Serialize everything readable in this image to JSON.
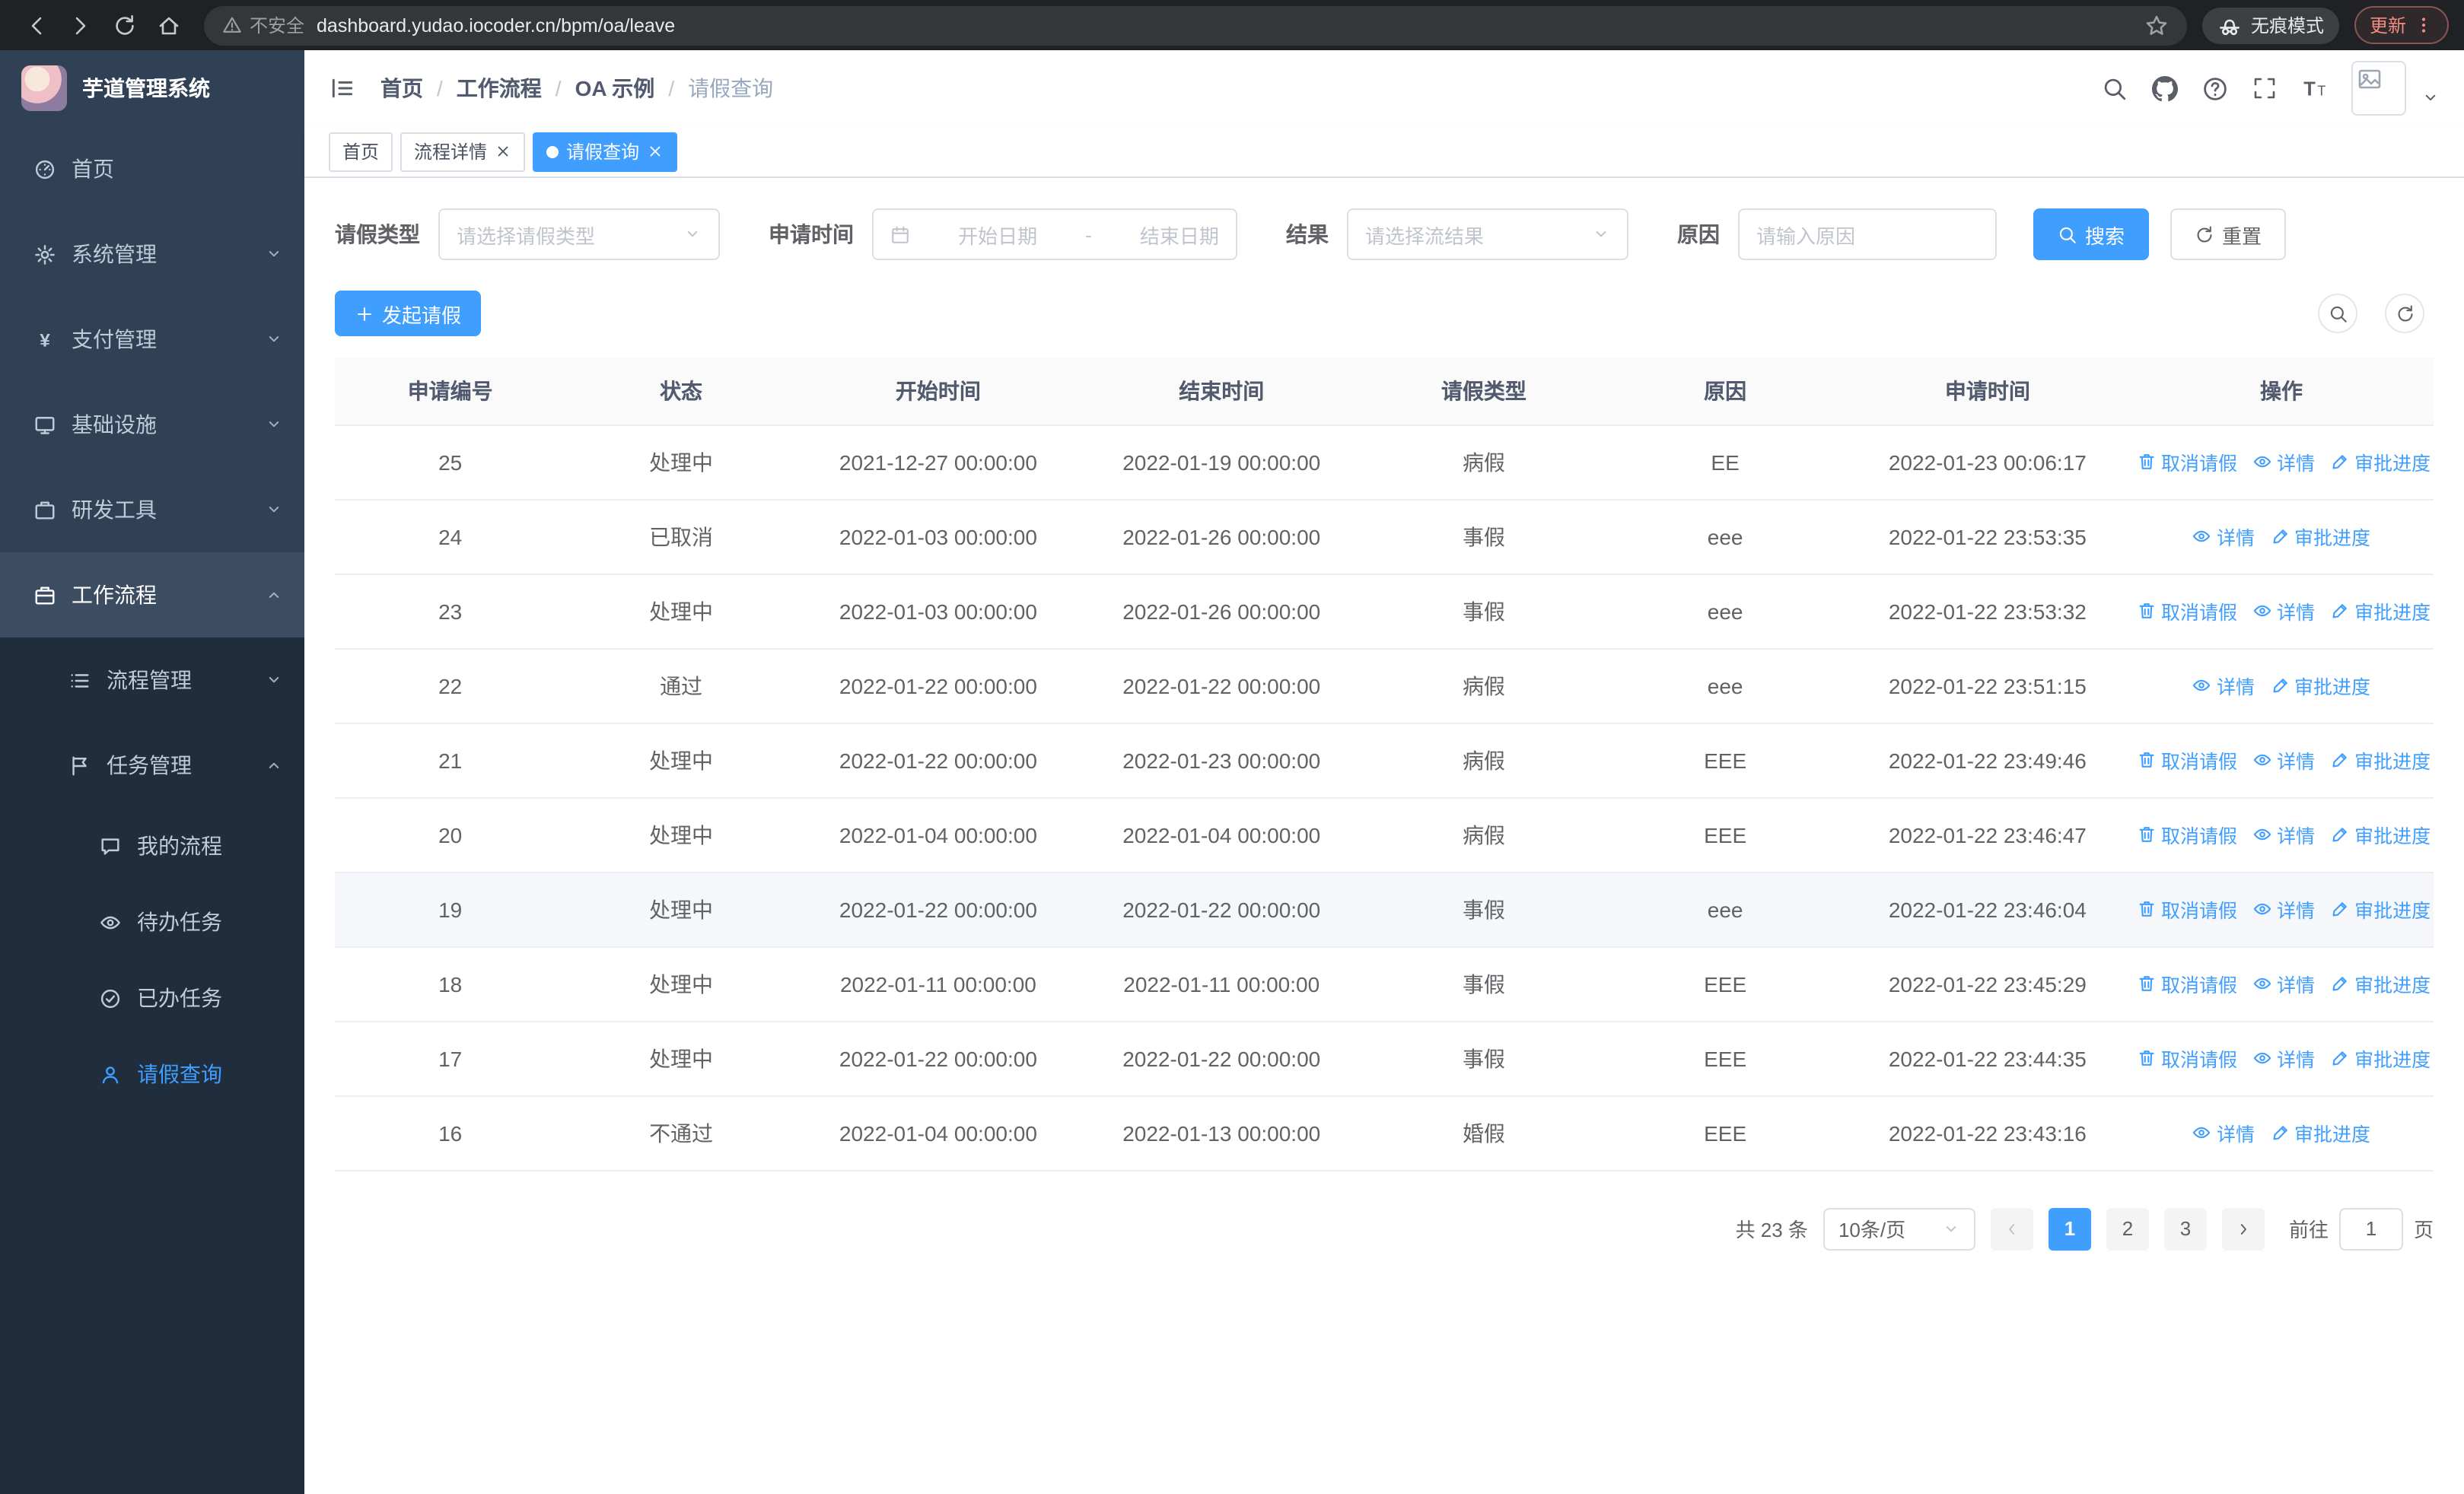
{
  "browser": {
    "security_warning": "不安全",
    "url": "dashboard.yudao.iocoder.cn/bpm/oa/leave",
    "incognito_label": "无痕模式",
    "update_label": "更新"
  },
  "sidebar": {
    "logo_title": "芋道管理系统",
    "top_items": [
      {
        "key": "home",
        "label": "首页",
        "icon": "home-icon"
      },
      {
        "key": "system",
        "label": "系统管理",
        "icon": "gear-icon",
        "chevron": "down"
      },
      {
        "key": "payment",
        "label": "支付管理",
        "icon": "yen-icon",
        "chevron": "down"
      },
      {
        "key": "infrastructure",
        "label": "基础设施",
        "icon": "monitor-icon",
        "chevron": "down"
      },
      {
        "key": "devtools",
        "label": "研发工具",
        "icon": "briefcase-icon",
        "chevron": "down"
      },
      {
        "key": "workflow",
        "label": "工作流程",
        "icon": "suitcase-icon",
        "chevron": "up",
        "open": true
      }
    ],
    "sub_items": [
      {
        "key": "process-mgmt",
        "label": "流程管理",
        "icon": "list-icon",
        "level": 2,
        "chevron": "down"
      },
      {
        "key": "task-mgmt",
        "label": "任务管理",
        "icon": "flag-icon",
        "level": 2,
        "chevron": "up"
      },
      {
        "key": "my-process",
        "label": "我的流程",
        "icon": "chat-icon",
        "level": 3
      },
      {
        "key": "todo-tasks",
        "label": "待办任务",
        "icon": "eye-icon",
        "level": 3
      },
      {
        "key": "done-tasks",
        "label": "已办任务",
        "icon": "check-circle-icon",
        "level": 3
      },
      {
        "key": "leave-query",
        "label": "请假查询",
        "icon": "user-icon",
        "level": 3,
        "active": true
      }
    ]
  },
  "header": {
    "breadcrumb_separator": "/",
    "breadcrumbs": [
      "首页",
      "工作流程",
      "OA 示例",
      "请假查询"
    ],
    "icons": [
      "search-icon",
      "github-icon",
      "help-icon",
      "fullscreen-icon",
      "font-size-icon",
      "user-avatar"
    ]
  },
  "tabs": [
    {
      "key": "home",
      "label": "首页",
      "closable": false,
      "active": false
    },
    {
      "key": "process-detail",
      "label": "流程详情",
      "closable": true,
      "active": false
    },
    {
      "key": "leave-query",
      "label": "请假查询",
      "closable": true,
      "active": true
    }
  ],
  "filters": {
    "leave_type_label": "请假类型",
    "leave_type_placeholder": "请选择请假类型",
    "apply_time_label": "申请时间",
    "start_date_placeholder": "开始日期",
    "range_separator": "-",
    "end_date_placeholder": "结束日期",
    "result_label": "结果",
    "result_placeholder": "请选择流结果",
    "reason_label": "原因",
    "reason_placeholder": "请输入原因",
    "search_button": "搜索",
    "reset_button": "重置"
  },
  "toolbar": {
    "create_button": "发起请假"
  },
  "table": {
    "columns": [
      "申请编号",
      "状态",
      "开始时间",
      "结束时间",
      "请假类型",
      "原因",
      "申请时间",
      "操作"
    ],
    "action_labels": {
      "cancel": "取消请假",
      "detail": "详情",
      "progress": "审批进度"
    },
    "action_icons": {
      "cancel": "trash-icon",
      "detail": "eye-icon",
      "progress": "edit-icon"
    },
    "rows": [
      {
        "id": "25",
        "status": "处理中",
        "start": "2021-12-27 00:00:00",
        "end": "2022-01-19 00:00:00",
        "type": "病假",
        "reason": "EE",
        "applied": "2022-01-23 00:06:17",
        "actions": [
          "cancel",
          "detail",
          "progress"
        ],
        "highlighted": false
      },
      {
        "id": "24",
        "status": "已取消",
        "start": "2022-01-03 00:00:00",
        "end": "2022-01-26 00:00:00",
        "type": "事假",
        "reason": "eee",
        "applied": "2022-01-22 23:53:35",
        "actions": [
          "detail",
          "progress"
        ],
        "highlighted": false
      },
      {
        "id": "23",
        "status": "处理中",
        "start": "2022-01-03 00:00:00",
        "end": "2022-01-26 00:00:00",
        "type": "事假",
        "reason": "eee",
        "applied": "2022-01-22 23:53:32",
        "actions": [
          "cancel",
          "detail",
          "progress"
        ],
        "highlighted": false
      },
      {
        "id": "22",
        "status": "通过",
        "start": "2022-01-22 00:00:00",
        "end": "2022-01-22 00:00:00",
        "type": "病假",
        "reason": "eee",
        "applied": "2022-01-22 23:51:15",
        "actions": [
          "detail",
          "progress"
        ],
        "highlighted": false
      },
      {
        "id": "21",
        "status": "处理中",
        "start": "2022-01-22 00:00:00",
        "end": "2022-01-23 00:00:00",
        "type": "病假",
        "reason": "EEE",
        "applied": "2022-01-22 23:49:46",
        "actions": [
          "cancel",
          "detail",
          "progress"
        ],
        "highlighted": false
      },
      {
        "id": "20",
        "status": "处理中",
        "start": "2022-01-04 00:00:00",
        "end": "2022-01-04 00:00:00",
        "type": "病假",
        "reason": "EEE",
        "applied": "2022-01-22 23:46:47",
        "actions": [
          "cancel",
          "detail",
          "progress"
        ],
        "highlighted": false
      },
      {
        "id": "19",
        "status": "处理中",
        "start": "2022-01-22 00:00:00",
        "end": "2022-01-22 00:00:00",
        "type": "事假",
        "reason": "eee",
        "applied": "2022-01-22 23:46:04",
        "actions": [
          "cancel",
          "detail",
          "progress"
        ],
        "highlighted": true
      },
      {
        "id": "18",
        "status": "处理中",
        "start": "2022-01-11 00:00:00",
        "end": "2022-01-11 00:00:00",
        "type": "事假",
        "reason": "EEE",
        "applied": "2022-01-22 23:45:29",
        "actions": [
          "cancel",
          "detail",
          "progress"
        ],
        "highlighted": false
      },
      {
        "id": "17",
        "status": "处理中",
        "start": "2022-01-22 00:00:00",
        "end": "2022-01-22 00:00:00",
        "type": "事假",
        "reason": "EEE",
        "applied": "2022-01-22 23:44:35",
        "actions": [
          "cancel",
          "detail",
          "progress"
        ],
        "highlighted": false
      },
      {
        "id": "16",
        "status": "不通过",
        "start": "2022-01-04 00:00:00",
        "end": "2022-01-13 00:00:00",
        "type": "婚假",
        "reason": "EEE",
        "applied": "2022-01-22 23:43:16",
        "actions": [
          "detail",
          "progress"
        ],
        "highlighted": false
      }
    ]
  },
  "pagination": {
    "total": "共 23 条",
    "page_size": "10条/页",
    "pages": [
      "1",
      "2",
      "3"
    ],
    "current": "1",
    "goto_label": "前往",
    "goto_value": "1",
    "goto_suffix": "页"
  }
}
